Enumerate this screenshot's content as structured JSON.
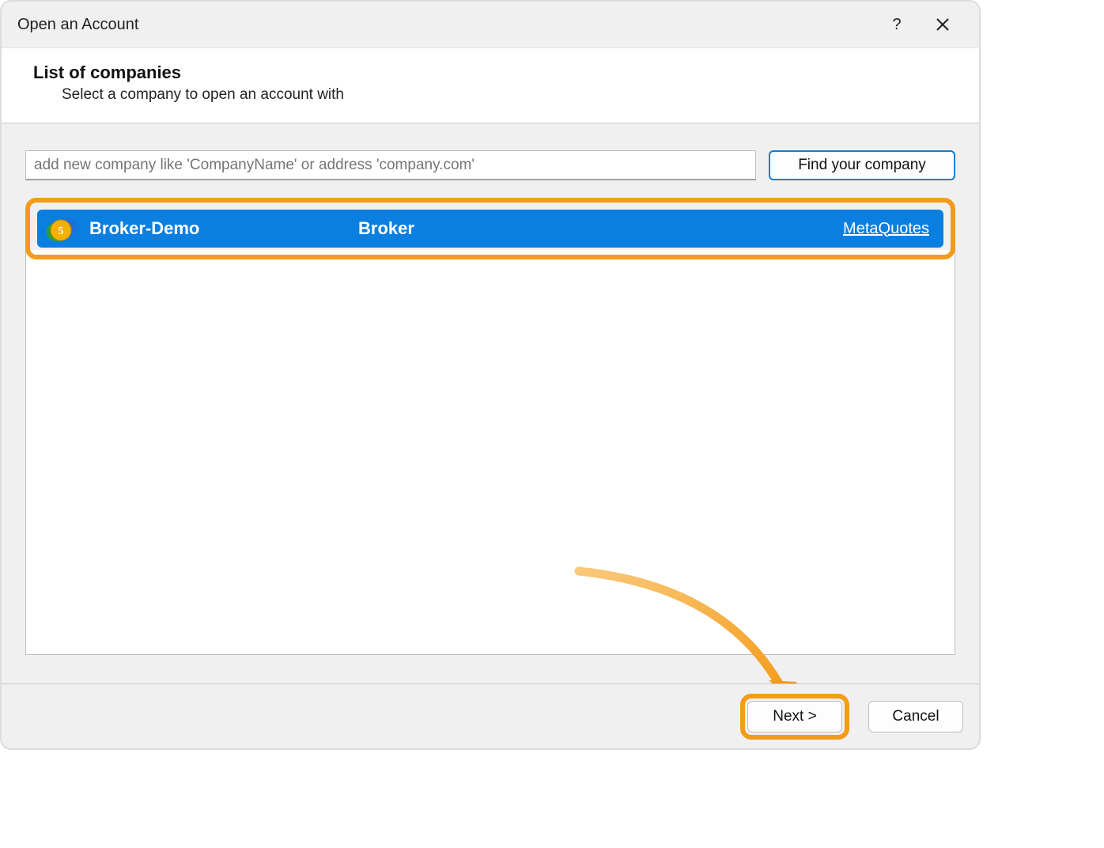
{
  "dialog": {
    "title": "Open an Account"
  },
  "header": {
    "heading": "List of companies",
    "subheading": "Select a company to open an account with"
  },
  "search": {
    "placeholder": "add new company like 'CompanyName' or address 'company.com'",
    "find_button": "Find your company"
  },
  "companies": [
    {
      "name": "Broker-Demo",
      "company": "Broker",
      "link_label": "MetaQuotes",
      "icon": "metaquotes-icon",
      "selected": true
    }
  ],
  "footer": {
    "next": "Next >",
    "cancel": "Cancel"
  },
  "annotations": {
    "highlight_row": true,
    "highlight_next": true,
    "arrow_from_row_to_next": true
  }
}
